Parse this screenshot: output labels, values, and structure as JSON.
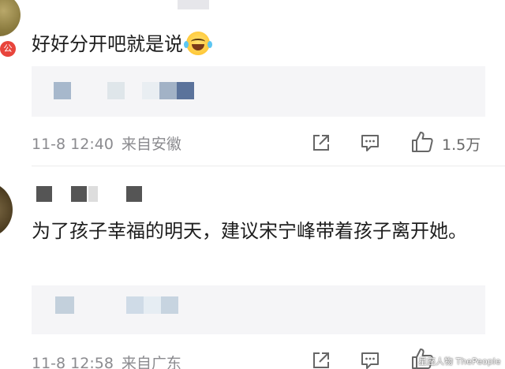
{
  "comments": [
    {
      "badge_char": "公",
      "text": "好好分开吧就是说",
      "emoji": "laugh-cry-emoji",
      "date": "11-8 12:40",
      "location": "来自安徽",
      "likes": "1.5万"
    },
    {
      "text": "为了孩子幸福的明天，建议宋宁峰带着孩子离开她。",
      "date": "11-8 12:58",
      "location": "来自广东"
    }
  ],
  "watermark": "星座人物 ThePeople",
  "colors": {
    "meta_text": "#8b8b8f",
    "quote_bg": "#f5f5f7",
    "badge": "#e8453c",
    "mosaic_blue": "#a7b8cc"
  },
  "icons": [
    "share-icon",
    "comment-icon",
    "like-icon"
  ]
}
